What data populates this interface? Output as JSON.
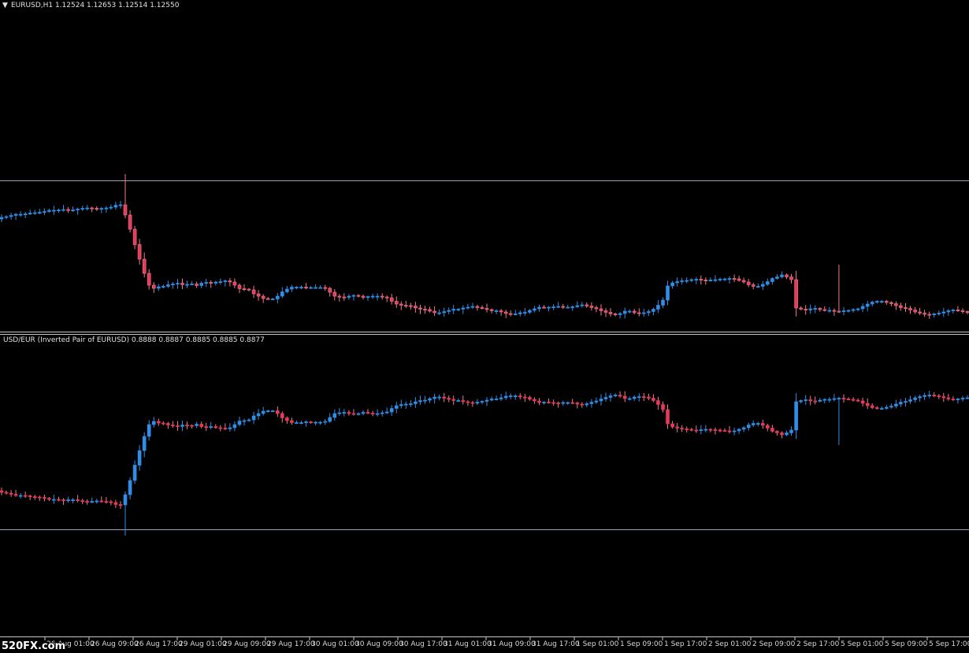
{
  "watermark": "520FX.com",
  "colors": {
    "background": "#000000",
    "bull": "#2f8fe8",
    "bear": "#e83a58",
    "bull_outline": "#2f8fe8",
    "bear_outline": "#f07a8c",
    "hline": "#9aa3b5",
    "separator": "#c8c8c8",
    "text": "#e0e0e0"
  },
  "chart_data": [
    {
      "type": "candlestick",
      "symbol_line": "EURUSD,H1  1.12524 1.12653 1.12514 1.12550",
      "title_marker": "▼",
      "horizontal_level": 0.77,
      "closes": [
        0.3,
        0.31,
        0.325,
        0.34,
        0.34,
        0.345,
        0.355,
        0.36,
        0.365,
        0.375,
        0.39,
        0.39,
        0.395,
        0.4,
        0.395,
        0.395,
        0.405,
        0.415,
        0.42,
        0.415,
        0.41,
        0.415,
        0.42,
        0.43,
        0.455,
        0.46,
        0.33,
        0.15,
        -0.045,
        -0.23,
        -0.41,
        -0.56,
        -0.6,
        -0.58,
        -0.575,
        -0.555,
        -0.545,
        -0.535,
        -0.555,
        -0.55,
        -0.545,
        -0.565,
        -0.535,
        -0.525,
        -0.535,
        -0.52,
        -0.515,
        -0.505,
        -0.52,
        -0.56,
        -0.605,
        -0.61,
        -0.62,
        -0.67,
        -0.7,
        -0.73,
        -0.735,
        -0.735,
        -0.7,
        -0.645,
        -0.61,
        -0.585,
        -0.585,
        -0.585,
        -0.595,
        -0.59,
        -0.59,
        -0.59,
        -0.6,
        -0.65,
        -0.7,
        -0.71,
        -0.715,
        -0.7,
        -0.69,
        -0.7,
        -0.715,
        -0.705,
        -0.7,
        -0.7,
        -0.71,
        -0.72,
        -0.765,
        -0.8,
        -0.815,
        -0.82,
        -0.825,
        -0.85,
        -0.865,
        -0.87,
        -0.89,
        -0.91,
        -0.91,
        -0.895,
        -0.88,
        -0.865,
        -0.865,
        -0.85,
        -0.84,
        -0.83,
        -0.845,
        -0.855,
        -0.87,
        -0.885,
        -0.885,
        -0.9,
        -0.92,
        -0.925,
        -0.925,
        -0.91,
        -0.905,
        -0.88,
        -0.86,
        -0.84,
        -0.845,
        -0.84,
        -0.835,
        -0.83,
        -0.84,
        -0.84,
        -0.835,
        -0.82,
        -0.81,
        -0.825,
        -0.845,
        -0.86,
        -0.885,
        -0.905,
        -0.925,
        -0.935,
        -0.92,
        -0.89,
        -0.89,
        -0.91,
        -0.915,
        -0.91,
        -0.895,
        -0.865,
        -0.815,
        -0.75,
        -0.57,
        -0.53,
        -0.515,
        -0.505,
        -0.5,
        -0.49,
        -0.485,
        -0.495,
        -0.5,
        -0.495,
        -0.49,
        -0.485,
        -0.48,
        -0.475,
        -0.48,
        -0.5,
        -0.52,
        -0.555,
        -0.575,
        -0.575,
        -0.55,
        -0.515,
        -0.475,
        -0.455,
        -0.43,
        -0.455,
        -0.49,
        -0.85,
        -0.865,
        -0.875,
        -0.86,
        -0.855,
        -0.87,
        -0.88,
        -0.88,
        -0.89,
        -0.895,
        -0.885,
        -0.88,
        -0.87,
        -0.86,
        -0.83,
        -0.8,
        -0.775,
        -0.765,
        -0.765,
        -0.78,
        -0.795,
        -0.82,
        -0.845,
        -0.855,
        -0.875,
        -0.9,
        -0.915,
        -0.93,
        -0.935,
        -0.925,
        -0.915,
        -0.9,
        -0.885,
        -0.875,
        -0.885,
        -0.895,
        -0.9
      ],
      "y_scale": {
        "mid": 306,
        "amp": 100
      }
    },
    {
      "type": "candlestick",
      "symbol_line": "USD/EUR (Inverted Pair of EURUSD) 0.8888 0.8887 0.8885 0.8885 0.8877",
      "horizontal_level": -0.77,
      "inverted_from_first": true,
      "y_scale": {
        "mid": 595,
        "amp": 100
      }
    }
  ],
  "x_axis": {
    "labels": [
      "26 Aug 01:00",
      "26 Aug 09:00",
      "26 Aug 17:00",
      "29 Aug 01:00",
      "29 Aug 09:00",
      "29 Aug 17:00",
      "30 Aug 01:00",
      "30 Aug 09:00",
      "30 Aug 17:00",
      "31 Aug 01:00",
      "31 Aug 09:00",
      "31 Aug 17:00",
      "1 Sep 01:00",
      "1 Sep 09:00",
      "1 Sep 17:00",
      "2 Sep 01:00",
      "2 Sep 09:00",
      "2 Sep 17:00",
      "5 Sep 01:00",
      "5 Sep 09:00",
      "5 Sep 17:00"
    ],
    "label_offset_candles": 8
  }
}
